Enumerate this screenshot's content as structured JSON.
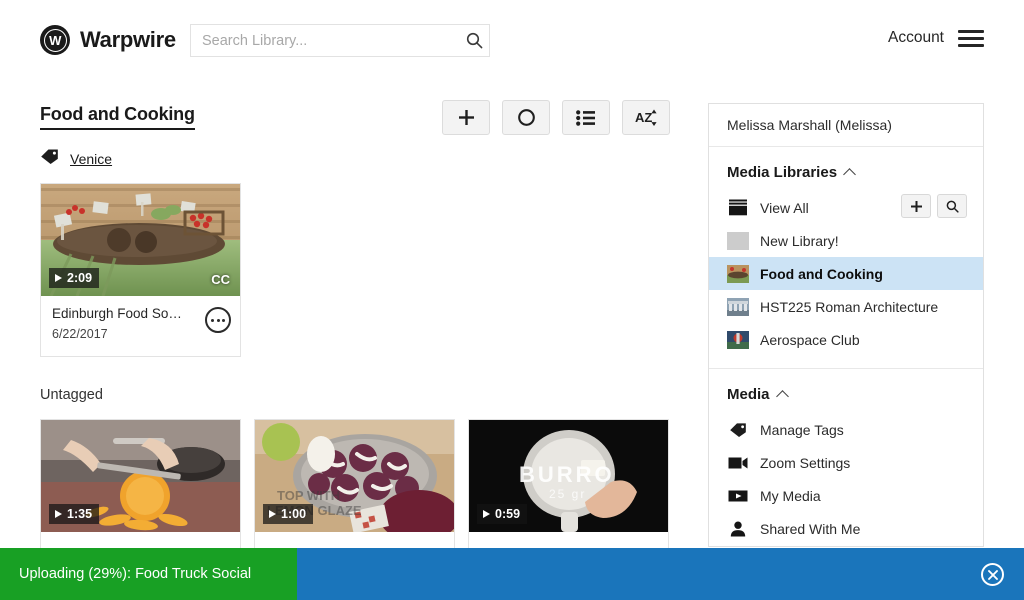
{
  "header": {
    "brand_initial": "W",
    "brand_name": "Warpwire",
    "search_placeholder": "Search Library...",
    "search_value": "",
    "account_label": "Account",
    "search_icon": "search-icon",
    "menu_icon": "hamburger-menu-icon"
  },
  "main": {
    "library_title": "Food and Cooking",
    "toolbar": [
      {
        "name": "add-media-button",
        "icon": "plus-icon"
      },
      {
        "name": "record-button",
        "icon": "circle-icon"
      },
      {
        "name": "list-view-button",
        "icon": "list-icon"
      },
      {
        "name": "sort-az-button",
        "icon": "sort-az-icon"
      }
    ],
    "tag": {
      "icon": "tag-icon",
      "label": "Venice"
    },
    "untagged_label": "Untagged",
    "tagged_cards": [
      {
        "title": "Edinburgh Food Soci...",
        "date": "6/22/2017",
        "duration": "2:09",
        "cc": "CC",
        "has_cc": true,
        "more_icon": "more-options-icon",
        "thumb": "market-produce"
      }
    ],
    "untagged_cards": [
      {
        "duration": "1:35",
        "thumb": "cutting-squash"
      },
      {
        "duration": "1:00",
        "thumb": "cinnamon-rolls"
      },
      {
        "duration": "0:59",
        "thumb": "burro-pan"
      }
    ]
  },
  "sidebar": {
    "user": "Melissa Marshall (Melissa)",
    "sections": [
      {
        "title": "Media Libraries",
        "collapse_icon": "chevron-up-icon",
        "actions": [
          {
            "name": "add-library-button",
            "icon": "plus-icon"
          },
          {
            "name": "search-libraries-button",
            "icon": "search-icon"
          }
        ],
        "items": [
          {
            "label": "View All",
            "thumb": "stack-icon",
            "active": false,
            "has_actions": true
          },
          {
            "label": "New Library!",
            "thumb": "blank-thumb",
            "active": false,
            "has_actions": false
          },
          {
            "label": "Food and Cooking",
            "thumb": "market-produce",
            "active": true,
            "has_actions": false
          },
          {
            "label": "HST225 Roman Architecture",
            "thumb": "roman-building",
            "active": false,
            "has_actions": false
          },
          {
            "label": "Aerospace Club",
            "thumb": "aerospace",
            "active": false,
            "has_actions": false
          }
        ]
      },
      {
        "title": "Media",
        "collapse_icon": "chevron-up-icon",
        "actions": [],
        "items": [
          {
            "label": "Manage Tags",
            "icon": "tag-icon",
            "active": false
          },
          {
            "label": "Zoom Settings",
            "icon": "video-camera-icon",
            "active": false
          },
          {
            "label": "My Media",
            "icon": "play-box-icon",
            "active": false
          },
          {
            "label": "Shared With Me",
            "icon": "person-icon",
            "active": false
          }
        ]
      }
    ]
  },
  "upload": {
    "text": "Uploading (29%): Food Truck Social",
    "percent": 29,
    "bar_color": "#18a024",
    "track_color": "#1a75bb",
    "close_icon": "close-circle-icon"
  }
}
